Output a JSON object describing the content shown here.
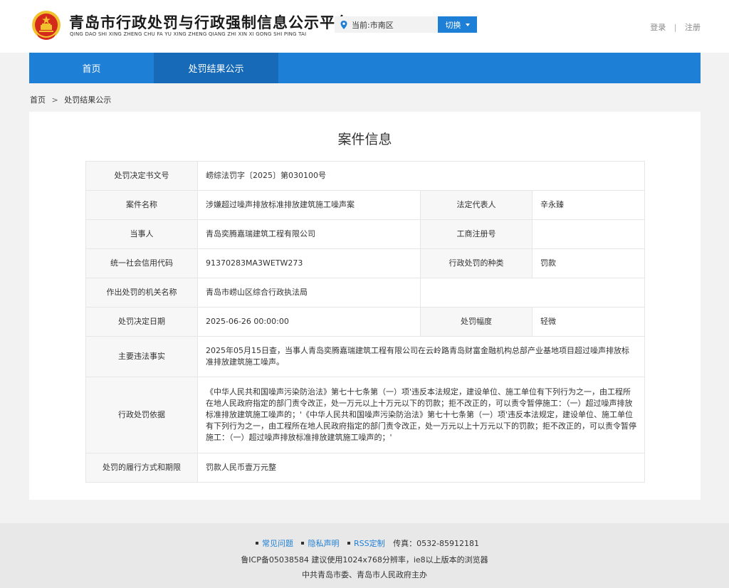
{
  "header": {
    "title": "青岛市行政处罚与行政强制信息公示平台",
    "subtitle": "QING DAO SHI XING ZHENG CHU FA YU XING ZHENG QIANG ZHI XIN XI GONG SHI PING TAI",
    "region": "当前:市南区",
    "switch_label": "切换",
    "login": "登录",
    "separator": "|",
    "register": "注册"
  },
  "nav": {
    "items": [
      {
        "label": "首页"
      },
      {
        "label": "处罚结果公示"
      }
    ]
  },
  "breadcrumb": {
    "home": "首页",
    "arrow": ">",
    "current": "处罚结果公示"
  },
  "card": {
    "title": "案件信息"
  },
  "case": {
    "doc_no_label": "处罚决定书文号",
    "doc_no": "崂综法罚字〔2025〕第030100号",
    "case_name_label": "案件名称",
    "case_name": "涉嫌超过噪声排放标准排放建筑施工噪声案",
    "legal_rep_label": "法定代表人",
    "legal_rep": "辛永臻",
    "party_label": "当事人",
    "party": "青岛奕腾嘉瑞建筑工程有限公司",
    "reg_no_label": "工商注册号",
    "reg_no": "",
    "credit_code_label": "统一社会信用代码",
    "credit_code": "91370283MA3WETW273",
    "penalty_type_label": "行政处罚的种类",
    "penalty_type": "罚款",
    "authority_label": "作出处罚的机关名称",
    "authority": "青岛市崂山区综合行政执法局",
    "date_label": "处罚决定日期",
    "date": "2025-06-26 00:00:00",
    "range_label": "处罚幅度",
    "range": "轻微",
    "facts_label": "主要违法事实",
    "facts": "2025年05月15日查，当事人青岛奕腾嘉瑞建筑工程有限公司在云岭路青岛财富金融机构总部产业基地项目超过噪声排放标准排放建筑施工噪声。",
    "basis_label": "行政处罚依据",
    "basis": "《中华人民共和国噪声污染防治法》第七十七条第（一）项'违反本法规定，建设单位、施工单位有下列行为之一，由工程所在地人民政府指定的部门责令改正，处一万元以上十万元以下的罚款；拒不改正的，可以责令暂停施工：（一）超过噪声排放标准排放建筑施工噪声的；'《中华人民共和国噪声污染防治法》第七十七条第（一）项'违反本法规定，建设单位、施工单位有下列行为之一，由工程所在地人民政府指定的部门责令改正，处一万元以上十万元以下的罚款；拒不改正的，可以责令暂停施工：（一）超过噪声排放标准排放建筑施工噪声的；'",
    "execution_label": "处罚的履行方式和期限",
    "execution": "罚款人民币壹万元整"
  },
  "footer": {
    "faq": "常见问题",
    "privacy": "隐私声明",
    "rss": "RSS定制",
    "fax": "传真：0532-85912181",
    "icp": "鲁ICP备05038584 建议使用1024x768分辨率，ie8以上版本的浏览器",
    "host": "中共青岛市委、青岛市人民政府主办"
  },
  "colors": {
    "brand_blue": "#1e7fd6",
    "nav_active": "#166ab8",
    "emblem_red": "#d42a1c",
    "emblem_gold": "#f2c12e"
  }
}
